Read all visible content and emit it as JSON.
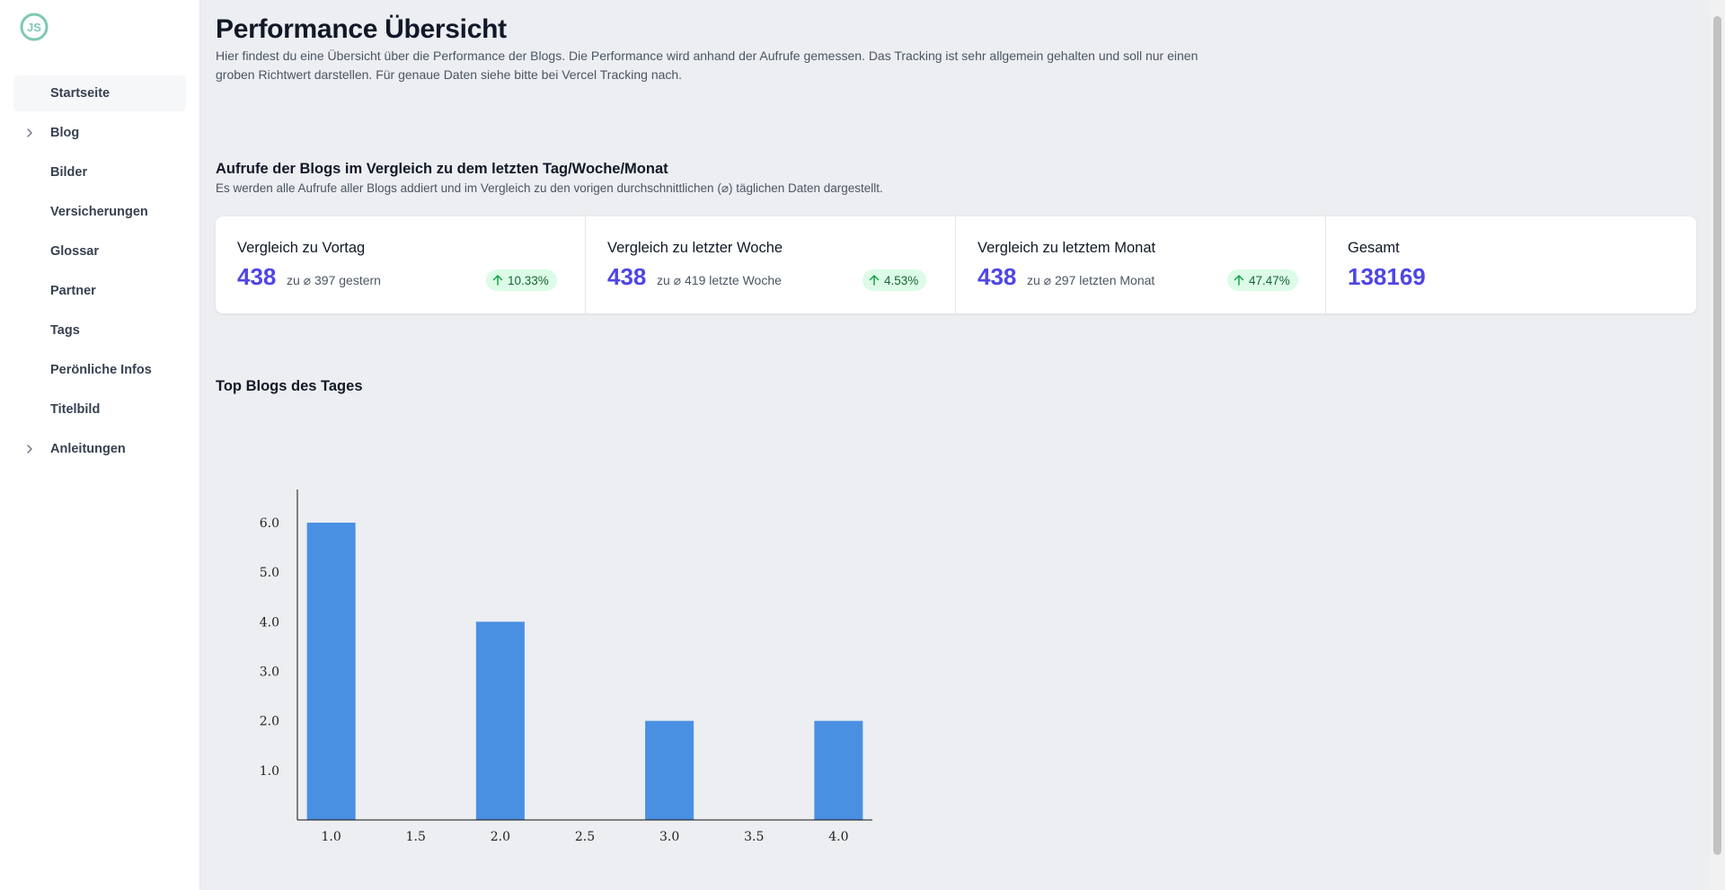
{
  "sidebar": {
    "logo_text": "JS",
    "items": [
      {
        "label": "Startseite",
        "expandable": false,
        "active": true
      },
      {
        "label": "Blog",
        "expandable": true,
        "active": false
      },
      {
        "label": "Bilder",
        "expandable": false,
        "active": false
      },
      {
        "label": "Versicherungen",
        "expandable": false,
        "active": false
      },
      {
        "label": "Glossar",
        "expandable": false,
        "active": false
      },
      {
        "label": "Partner",
        "expandable": false,
        "active": false
      },
      {
        "label": "Tags",
        "expandable": false,
        "active": false
      },
      {
        "label": "Perönliche Infos",
        "expandable": false,
        "active": false
      },
      {
        "label": "Titelbild",
        "expandable": false,
        "active": false
      },
      {
        "label": "Anleitungen",
        "expandable": true,
        "active": false
      }
    ]
  },
  "header": {
    "title": "Performance Übersicht",
    "description": "Hier findest du eine Übersicht über die Performance der Blogs. Die Performance wird anhand der Aufrufe gemessen. Das Tracking ist sehr allgemein gehalten und soll nur einen groben Richtwert darstellen. Für genaue Daten siehe bitte bei Vercel Tracking nach."
  },
  "comparison": {
    "title": "Aufrufe der Blogs im Vergleich zu dem letzten Tag/Woche/Monat",
    "description": "Es werden alle Aufrufe aller Blogs addiert und im Vergleich zu den vorigen durchschnittlichen (⌀) täglichen Daten dargestellt.",
    "stats": [
      {
        "label": "Vergleich zu Vortag",
        "value": "438",
        "sub": "zu ⌀ 397 gestern",
        "change": "10.33%",
        "trend": "up"
      },
      {
        "label": "Vergleich zu letzter Woche",
        "value": "438",
        "sub": "zu ⌀ 419 letzte Woche",
        "change": "4.53%",
        "trend": "up"
      },
      {
        "label": "Vergleich zu letztem Monat",
        "value": "438",
        "sub": "zu ⌀ 297 letzten Monat",
        "change": "47.47%",
        "trend": "up"
      },
      {
        "label": "Gesamt",
        "value": "138169"
      }
    ]
  },
  "top_blogs": {
    "title": "Top Blogs des Tages"
  },
  "colors": {
    "accent": "#4f46e5",
    "bar": "#4a90e2",
    "badge_bg": "#dcfce7",
    "badge_text": "#166534",
    "logo": "#7fc8b4"
  },
  "chart_data": {
    "type": "bar",
    "x": [
      1.0,
      2.0,
      3.0,
      4.0
    ],
    "values": [
      6,
      4,
      2,
      2
    ],
    "xticks": [
      "1.0",
      "1.5",
      "2.0",
      "2.5",
      "3.0",
      "3.5",
      "4.0"
    ],
    "yticks": [
      "1.0",
      "2.0",
      "3.0",
      "4.0",
      "5.0",
      "6.0"
    ],
    "xlim": [
      0.8,
      4.2
    ],
    "ylim": [
      0,
      6.67
    ],
    "title": "",
    "xlabel": "",
    "ylabel": "",
    "grid": false
  }
}
